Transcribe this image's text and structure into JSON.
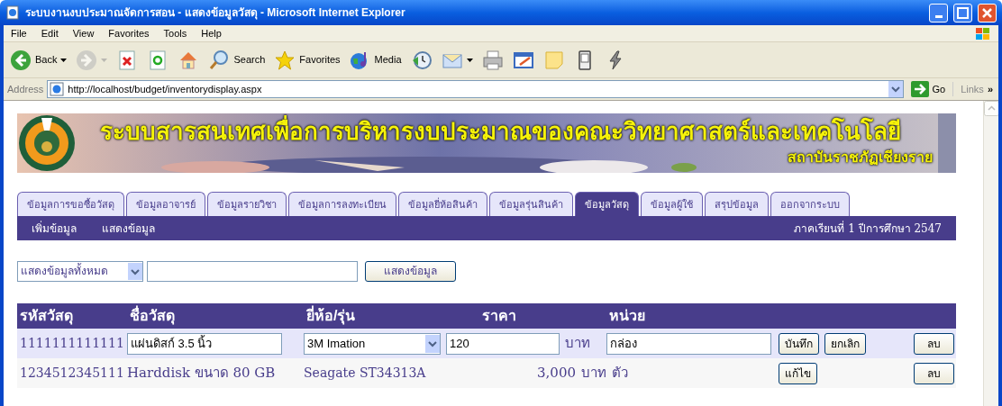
{
  "window": {
    "title": "ระบบงานงบประมาณจัดการสอน - แสดงข้อมูลวัสดุ - Microsoft Internet Explorer"
  },
  "menu": [
    "File",
    "Edit",
    "View",
    "Favorites",
    "Tools",
    "Help"
  ],
  "toolbar": [
    {
      "kind": "back",
      "label": "Back",
      "dropdown": true,
      "disabled": false
    },
    {
      "kind": "forward",
      "dropdown": true,
      "disabled": true
    },
    {
      "kind": "stop",
      "dropdown": false,
      "disabled": false
    },
    {
      "kind": "refresh",
      "dropdown": false,
      "disabled": false
    },
    {
      "kind": "home",
      "dropdown": false,
      "disabled": false
    },
    {
      "kind": "search",
      "label": "Search",
      "dropdown": false,
      "disabled": false
    },
    {
      "kind": "favorites",
      "label": "Favorites",
      "dropdown": false,
      "disabled": false
    },
    {
      "kind": "media",
      "label": "Media",
      "dropdown": false,
      "disabled": false
    },
    {
      "kind": "history",
      "dropdown": false,
      "disabled": false
    },
    {
      "kind": "mail",
      "dropdown": true,
      "disabled": false
    },
    {
      "kind": "print",
      "dropdown": false,
      "disabled": false
    },
    {
      "kind": "edit",
      "dropdown": false,
      "disabled": false
    },
    {
      "kind": "note",
      "dropdown": false,
      "disabled": false
    },
    {
      "kind": "messenger",
      "dropdown": false,
      "disabled": false
    },
    {
      "kind": "research",
      "dropdown": false,
      "disabled": false
    }
  ],
  "address": {
    "label": "Address",
    "value": "http://localhost/budget/inventorydisplay.aspx",
    "go": "Go",
    "links": "Links",
    "more": "»"
  },
  "banner": {
    "kind": "picture",
    "title": "ระบบสารสนเทศเพื่อการบริหารงบประมาณของคณะวิทยาศาสตร์และเทคโนโลยี",
    "subtitle": "สถาบันราชภัฏเชียงราย"
  },
  "tabs": [
    {
      "label": "ข้อมูลการขอซื้อวัสดุ",
      "selected": false
    },
    {
      "label": "ข้อมูลอาจารย์",
      "selected": false
    },
    {
      "label": "ข้อมูลรายวิชา",
      "selected": false
    },
    {
      "label": "ข้อมูลการลงทะเบียน",
      "selected": false
    },
    {
      "label": "ข้อมูลยี่ห้อสินค้า",
      "selected": false
    },
    {
      "label": "ข้อมูลรุ่นสินค้า",
      "selected": false
    },
    {
      "label": "ข้อมูลวัสดุ",
      "selected": true
    },
    {
      "label": "ข้อมูลผู้ใช้",
      "selected": false
    },
    {
      "label": "สรุปข้อมูล",
      "selected": false
    },
    {
      "label": "ออกจากระบบ",
      "selected": false
    }
  ],
  "subnav": [
    "เพิ่มข้อมูล",
    "แสดงข้อมูล"
  ],
  "term": "ภาคเรียนที่ 1 ปีการศึกษา 2547",
  "filter": {
    "select": "แสดงข้อมูลทั้งหมด",
    "button": "แสดงข้อมูล"
  },
  "table": {
    "columns": [
      "รหัสวัสดุ",
      "ชื่อวัสดุ",
      "ยี่ห้อ/รุ่น",
      "ราคา",
      "หน่วย"
    ],
    "rows": [
      {
        "kind": "editing",
        "code": "1111111111111",
        "name": "แผ่นดิสก์ 3.5 นิ้ว",
        "brand": "3M Imation",
        "price": "120",
        "currency": "บาท",
        "unit": "กล่อง",
        "buttons": [
          "บันทึก",
          "ยกเลิก"
        ],
        "delete": "ลบ"
      },
      {
        "kind": "view",
        "code": "1234512345111",
        "name": "Harddisk ขนาด 80 GB",
        "brand": "Seagate ST34313A",
        "price": "3,000",
        "currency": "บาท",
        "unit": "ตัว",
        "buttons": [
          "แก้ไข"
        ],
        "delete": "ลบ"
      }
    ]
  }
}
